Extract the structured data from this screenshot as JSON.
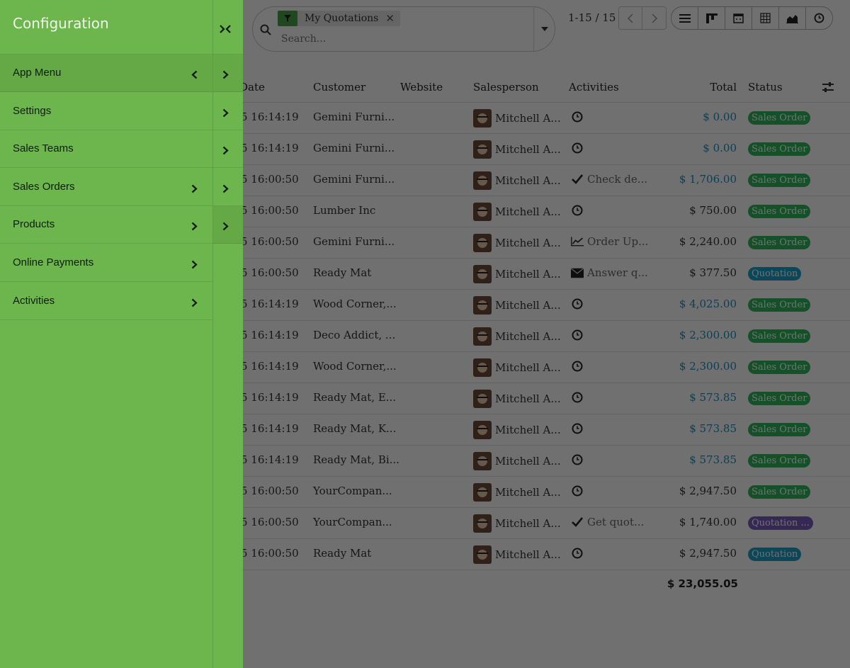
{
  "drawer": {
    "title": "Configuration",
    "items": [
      {
        "label": "App Menu",
        "chevron": "chevron-left-icon"
      },
      {
        "label": "Settings",
        "chevron": ""
      },
      {
        "label": "Sales Teams",
        "chevron": ""
      },
      {
        "label": "Sales Orders",
        "chevron": "chevron-right-icon"
      },
      {
        "label": "Products",
        "chevron": "chevron-right-icon"
      },
      {
        "label": "Online Payments",
        "chevron": "chevron-right-icon"
      },
      {
        "label": "Activities",
        "chevron": "chevron-right-icon"
      }
    ],
    "colors": {
      "background": "#6db54d",
      "text": "#0d1b0a"
    }
  },
  "search": {
    "facet_label": "My Quotations",
    "placeholder": "Search..."
  },
  "pager": {
    "text": "1-15 / 15"
  },
  "table": {
    "headers": {
      "date": "Date",
      "customer": "Customer",
      "website": "Website",
      "salesperson": "Salesperson",
      "activities": "Activities",
      "total": "Total",
      "status": "Status"
    },
    "rows": [
      {
        "date": "5 16:14:19",
        "customer": "Gemini Furni...",
        "salesperson": "Mitchell A...",
        "activity_icon": "clock-icon",
        "activity": "",
        "total": "$ 0.00",
        "total_color": "blue",
        "status": "Sales Order"
      },
      {
        "date": "5 16:14:19",
        "customer": "Gemini Furni...",
        "salesperson": "Mitchell A...",
        "activity_icon": "clock-icon",
        "activity": "",
        "total": "$ 0.00",
        "total_color": "blue",
        "status": "Sales Order"
      },
      {
        "date": "5 16:00:50",
        "customer": "Gemini Furni...",
        "salesperson": "Mitchell A...",
        "activity_icon": "check-icon",
        "activity": "Check de...",
        "total": "$ 1,706.00",
        "total_color": "blue",
        "status": "Sales Order"
      },
      {
        "date": "5 16:00:50",
        "customer": "Lumber Inc",
        "salesperson": "Mitchell A...",
        "activity_icon": "clock-icon",
        "activity": "",
        "total": "$ 750.00",
        "total_color": "dark",
        "status": "Sales Order"
      },
      {
        "date": "5 16:00:50",
        "customer": "Gemini Furni...",
        "salesperson": "Mitchell A...",
        "activity_icon": "chart-line-icon",
        "activity": "Order Up...",
        "total": "$ 2,240.00",
        "total_color": "dark",
        "status": "Sales Order"
      },
      {
        "date": "5 16:00:50",
        "customer": "Ready Mat",
        "salesperson": "Mitchell A...",
        "activity_icon": "envelope-icon",
        "activity": "Answer q...",
        "total": "$ 377.50",
        "total_color": "dark",
        "status": "Quotation"
      },
      {
        "date": "5 16:14:19",
        "customer": "Wood Corner,...",
        "salesperson": "Mitchell A...",
        "activity_icon": "clock-icon",
        "activity": "",
        "total": "$ 4,025.00",
        "total_color": "blue",
        "status": "Sales Order"
      },
      {
        "date": "5 16:14:19",
        "customer": "Deco Addict, ...",
        "salesperson": "Mitchell A...",
        "activity_icon": "clock-icon",
        "activity": "",
        "total": "$ 2,300.00",
        "total_color": "blue",
        "status": "Sales Order"
      },
      {
        "date": "5 16:14:19",
        "customer": "Wood Corner,...",
        "salesperson": "Mitchell A...",
        "activity_icon": "clock-icon",
        "activity": "",
        "total": "$ 2,300.00",
        "total_color": "blue",
        "status": "Sales Order"
      },
      {
        "date": "5 16:14:19",
        "customer": "Ready Mat, E...",
        "salesperson": "Mitchell A...",
        "activity_icon": "clock-icon",
        "activity": "",
        "total": "$ 573.85",
        "total_color": "blue",
        "status": "Sales Order"
      },
      {
        "date": "5 16:14:19",
        "customer": "Ready Mat, K...",
        "salesperson": "Mitchell A...",
        "activity_icon": "clock-icon",
        "activity": "",
        "total": "$ 573.85",
        "total_color": "blue",
        "status": "Sales Order"
      },
      {
        "date": "5 16:14:19",
        "customer": "Ready Mat, Bi...",
        "salesperson": "Mitchell A...",
        "activity_icon": "clock-icon",
        "activity": "",
        "total": "$ 573.85",
        "total_color": "blue",
        "status": "Sales Order"
      },
      {
        "date": "5 16:00:50",
        "customer": "YourCompan...",
        "salesperson": "Mitchell A...",
        "activity_icon": "clock-icon",
        "activity": "",
        "total": "$ 2,947.50",
        "total_color": "dark",
        "status": "Sales Order"
      },
      {
        "date": "5 16:00:50",
        "customer": "YourCompan...",
        "salesperson": "Mitchell A...",
        "activity_icon": "check-icon",
        "activity": "Get quot...",
        "total": "$ 1,740.00",
        "total_color": "dark",
        "status": "Quotation ..."
      },
      {
        "date": "5 16:00:50",
        "customer": "Ready Mat",
        "salesperson": "Mitchell A...",
        "activity_icon": "clock-icon",
        "activity": "",
        "total": "$ 2,947.50",
        "total_color": "dark",
        "status": "Quotation"
      }
    ],
    "grand_total": "$ 23,055.05"
  },
  "colors": {
    "sales_order_badge": "#2fb95f",
    "quotation_badge": "#1aa3c9",
    "quotation_sent_badge": "#7a5fbf",
    "amount_blue": "#1a8fbf"
  }
}
